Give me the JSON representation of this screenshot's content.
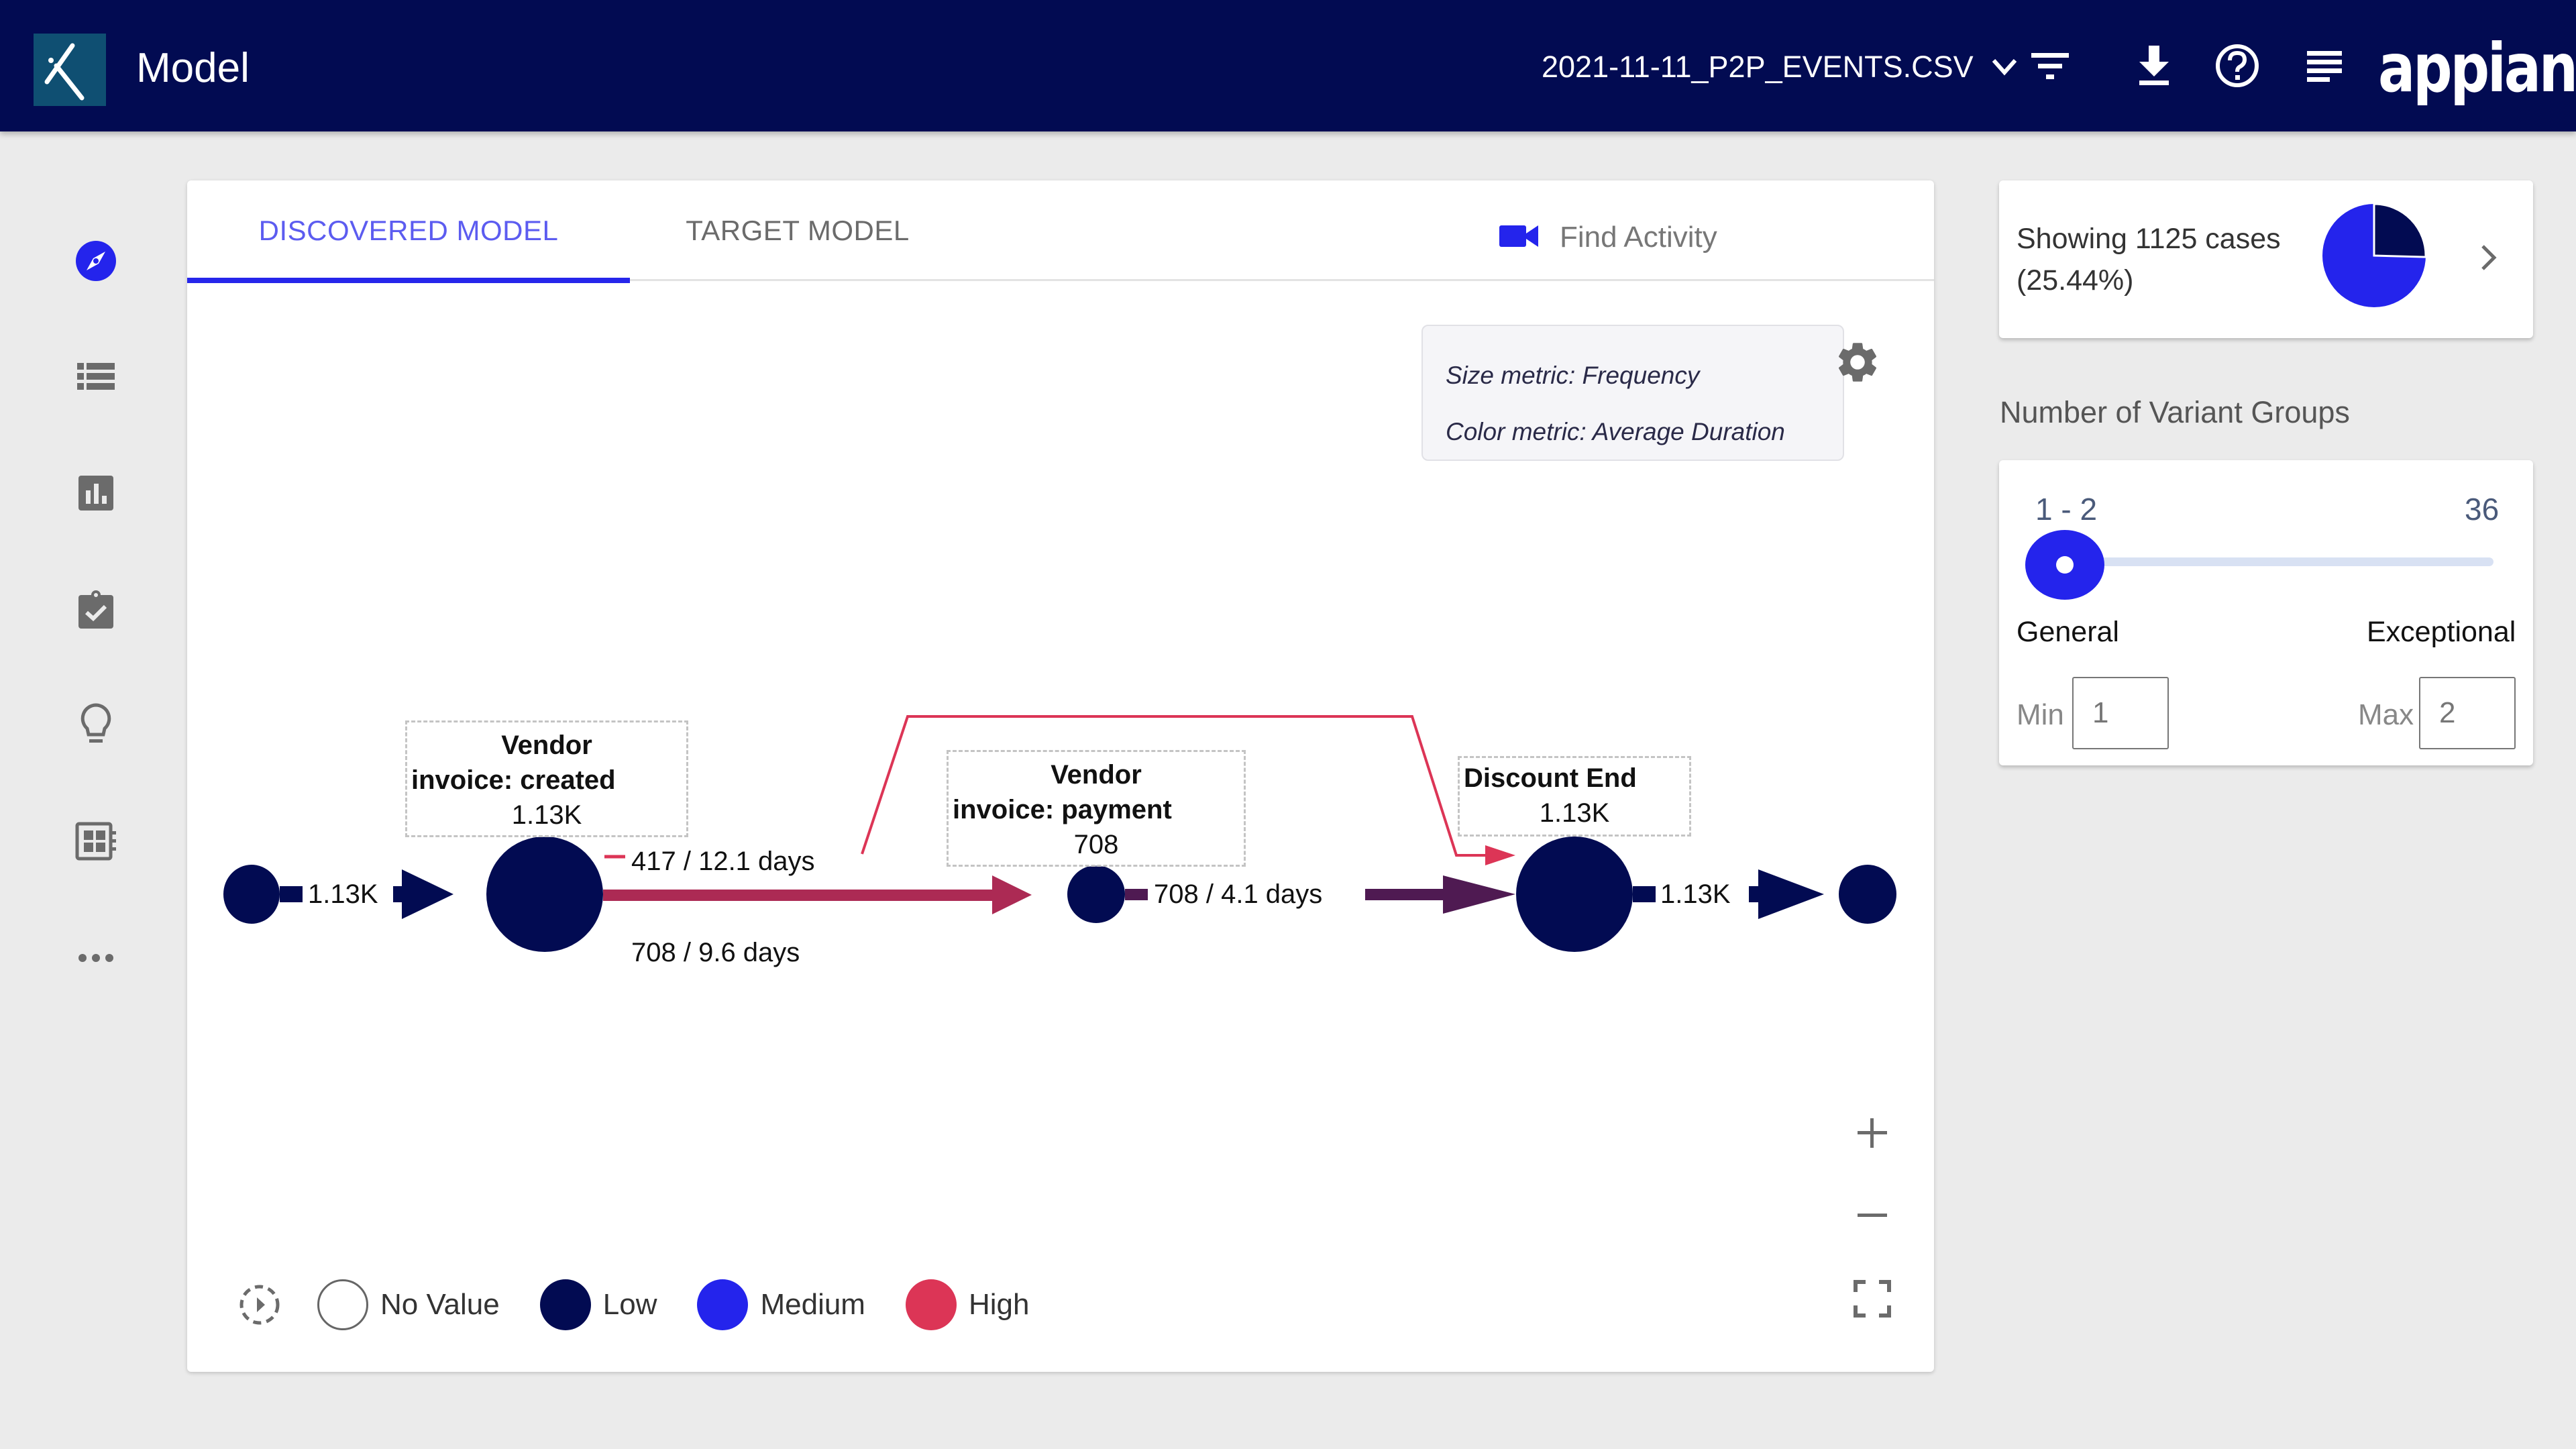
{
  "header": {
    "app_title": "Model",
    "file_name": "2021-11-11_P2P_EVENTS.CSV",
    "icons": [
      "logo-icon",
      "chevron-down-icon",
      "filter-icon",
      "download-icon",
      "help-icon",
      "menu-icon"
    ],
    "brand": "appian"
  },
  "sidebar": {
    "items": [
      {
        "icon": "compass-icon",
        "active": true
      },
      {
        "icon": "list-icon",
        "active": false
      },
      {
        "icon": "bar-chart-icon",
        "active": false
      },
      {
        "icon": "clipboard-check-icon",
        "active": false
      },
      {
        "icon": "lightbulb-icon",
        "active": false
      },
      {
        "icon": "dashboard-icon",
        "active": false
      },
      {
        "icon": "more-icon",
        "active": false
      }
    ]
  },
  "main": {
    "tabs": [
      {
        "label": "DISCOVERED MODEL",
        "active": true
      },
      {
        "label": "TARGET MODEL",
        "active": false
      }
    ],
    "find_activity": "Find Activity",
    "metrics": {
      "size": "Size metric: Frequency",
      "color": "Color metric: Average Duration"
    },
    "graph": {
      "nodes": [
        {
          "id": "start",
          "type": "start"
        },
        {
          "id": "created",
          "name_line1": "Vendor",
          "name_line2": "invoice: created",
          "count": "1.13K",
          "color_level": "Low"
        },
        {
          "id": "payment",
          "name_line1": "Vendor",
          "name_line2": "invoice: payment",
          "count": "708",
          "color_level": "Low"
        },
        {
          "id": "discount_end",
          "name_line1": "Discount End",
          "count": "1.13K",
          "color_level": "Low"
        },
        {
          "id": "end",
          "type": "end"
        }
      ],
      "edges": [
        {
          "from": "start",
          "to": "created",
          "label": "1.13K"
        },
        {
          "from": "created",
          "to": "payment",
          "label": "708 / 9.6 days"
        },
        {
          "from": "created",
          "to": "discount_end",
          "label": "417 / 12.1 days"
        },
        {
          "from": "payment",
          "to": "discount_end",
          "label": "708 / 4.1 days"
        },
        {
          "from": "discount_end",
          "to": "end",
          "label": "1.13K"
        }
      ]
    },
    "legend": [
      {
        "label": "No Value",
        "color": "#ffffff"
      },
      {
        "label": "Low",
        "color": "#020b52"
      },
      {
        "label": "Medium",
        "color": "#2424ec"
      },
      {
        "label": "High",
        "color": "#dc3556"
      }
    ],
    "zoom_controls": [
      "zoom-in-icon",
      "zoom-out-icon",
      "fullscreen-icon"
    ]
  },
  "cases": {
    "line1": "Showing 1125 cases",
    "line2": "(25.44%)",
    "shown_fraction": 0.2544,
    "colors": {
      "shown": "#020b52",
      "rest": "#2424ec"
    }
  },
  "variants": {
    "title": "Number of Variant Groups",
    "range_label": "1 - 2",
    "max_label": "36",
    "left_label": "General",
    "right_label": "Exceptional",
    "min_label": "Min",
    "min_value": "1",
    "max_field_label": "Max",
    "max_value": "2"
  },
  "colors": {
    "header_bg": "#020b52",
    "accent": "#2424ec",
    "edge_high": "#ac2a54",
    "edge_mid": "#4f1a52",
    "edge_thin": "#dc3556"
  }
}
